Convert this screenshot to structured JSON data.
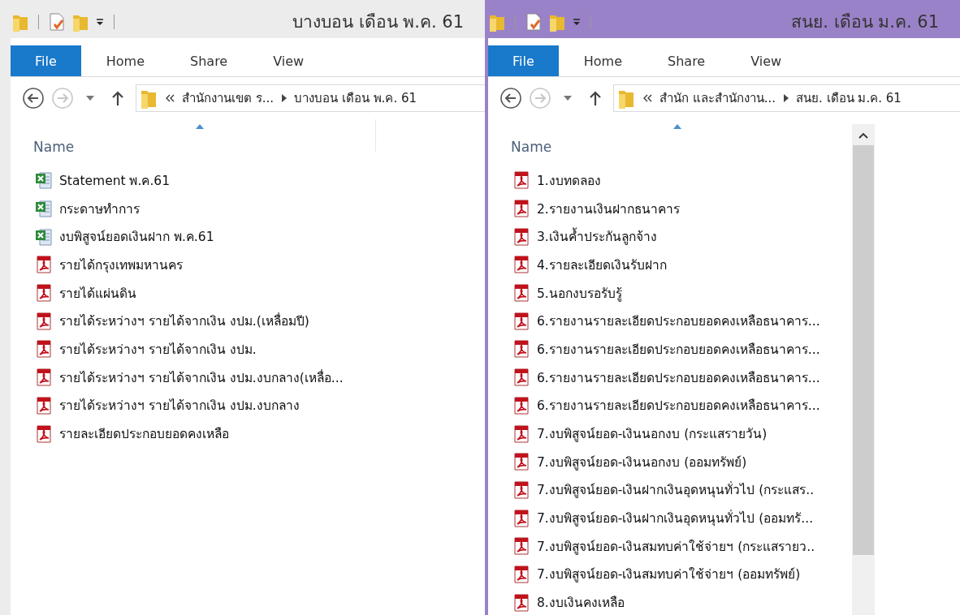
{
  "windows": [
    {
      "title": "บางบอน เดือน พ.ค. 61",
      "active": false,
      "back_enabled": true,
      "forward_enabled": false,
      "scrollbar": false,
      "tabs": [
        {
          "label": "File",
          "selected": true
        },
        {
          "label": "Home",
          "selected": false
        },
        {
          "label": "Share",
          "selected": false
        },
        {
          "label": "View",
          "selected": false
        }
      ],
      "path": [
        "สำนักงานเขต ร...",
        "บางบอน เดือน พ.ค. 61"
      ],
      "column": "Name",
      "files": [
        {
          "name": "Statement พ.ค.61",
          "kind": "excel"
        },
        {
          "name": "กระดาษทำการ",
          "kind": "excel"
        },
        {
          "name": "งบพิสูจน์ยอดเงินฝาก พ.ค.61",
          "kind": "excel"
        },
        {
          "name": "รายได้กรุงเทพมหานคร",
          "kind": "pdf"
        },
        {
          "name": "รายได้แผ่นดิน",
          "kind": "pdf"
        },
        {
          "name": "รายได้ระหว่างฯ รายได้จากเงิน งปม.(เหลื่อมปี)",
          "kind": "pdf"
        },
        {
          "name": "รายได้ระหว่างฯ รายได้จากเงิน งปม.",
          "kind": "pdf"
        },
        {
          "name": "รายได้ระหว่างฯ รายได้จากเงิน งปม.งบกลาง(เหลื่อ...",
          "kind": "pdf"
        },
        {
          "name": "รายได้ระหว่างฯ รายได้จากเงิน งปม.งบกลาง",
          "kind": "pdf"
        },
        {
          "name": "รายละเอียดประกอบยอดคงเหลือ",
          "kind": "pdf"
        }
      ]
    },
    {
      "title": "สนย. เดือน ม.ค. 61",
      "active": true,
      "back_enabled": true,
      "forward_enabled": false,
      "scrollbar": true,
      "tabs": [
        {
          "label": "File",
          "selected": true
        },
        {
          "label": "Home",
          "selected": false
        },
        {
          "label": "Share",
          "selected": false
        },
        {
          "label": "View",
          "selected": false
        }
      ],
      "path": [
        "สำนัก และสำนักงาน...",
        "สนย. เดือน ม.ค. 61"
      ],
      "column": "Name",
      "files": [
        {
          "name": "1.งบทดลอง",
          "kind": "pdf"
        },
        {
          "name": "2.รายงานเงินฝากธนาคาร",
          "kind": "pdf"
        },
        {
          "name": "3.เงินค้ำประกันลูกจ้าง",
          "kind": "pdf"
        },
        {
          "name": "4.รายละเอียดเงินรับฝาก",
          "kind": "pdf"
        },
        {
          "name": "5.นอกงบรอรับรู้",
          "kind": "pdf"
        },
        {
          "name": "6.รายงานรายละเอียดประกอบยอดคงเหลือธนาคาร...",
          "kind": "pdf"
        },
        {
          "name": "6.รายงานรายละเอียดประกอบยอดคงเหลือธนาคาร...",
          "kind": "pdf"
        },
        {
          "name": "6.รายงานรายละเอียดประกอบยอดคงเหลือธนาคาร...",
          "kind": "pdf"
        },
        {
          "name": "6.รายงานรายละเอียดประกอบยอดคงเหลือธนาคาร...",
          "kind": "pdf"
        },
        {
          "name": "7.งบพิสูจน์ยอด-เงินนอกงบ (กระแสรายวัน)",
          "kind": "pdf"
        },
        {
          "name": "7.งบพิสูจน์ยอด-เงินนอกงบ (ออมทรัพย์)",
          "kind": "pdf"
        },
        {
          "name": "7.งบพิสูจน์ยอด-เงินฝากเงินอุดหนุนทั่วไป (กระแสร..",
          "kind": "pdf"
        },
        {
          "name": "7.งบพิสูจน์ยอด-เงินฝากเงินอุดหนุนทั่วไป (ออมทรั...",
          "kind": "pdf"
        },
        {
          "name": "7.งบพิสูจน์ยอด-เงินสมทบค่าใช้จ่ายฯ (กระแสรายว..",
          "kind": "pdf"
        },
        {
          "name": "7.งบพิสูจน์ยอด-เงินสมทบค่าใช้จ่ายฯ (ออมทรัพย์)",
          "kind": "pdf"
        },
        {
          "name": "8.งบเงินคงเหลือ",
          "kind": "pdf"
        }
      ]
    }
  ]
}
